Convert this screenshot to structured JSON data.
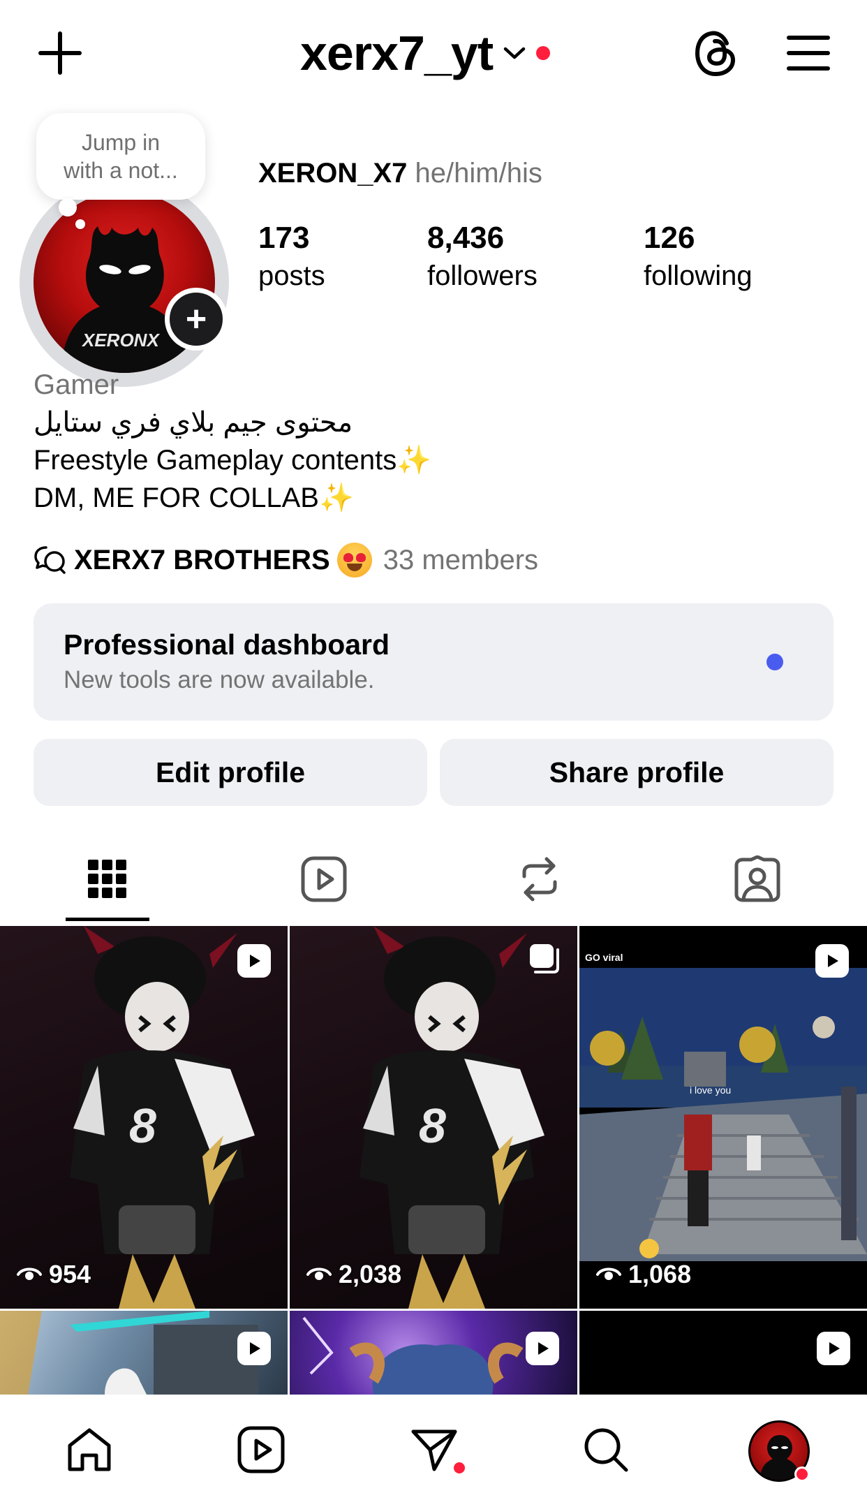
{
  "header": {
    "username": "xerx7_yt",
    "icons": [
      "plus-icon",
      "chevron-down-icon",
      "threads-icon",
      "menu-icon"
    ]
  },
  "note": {
    "line1": "Jump in",
    "line2": "with a not..."
  },
  "profile": {
    "display_name": "XERON_X7",
    "pronouns": "he/him/his",
    "avatar_text": "XERONX",
    "stats": {
      "posts": {
        "value": "173",
        "label": "posts"
      },
      "followers": {
        "value": "8,436",
        "label": "followers"
      },
      "following": {
        "value": "126",
        "label": "following"
      }
    }
  },
  "bio": {
    "category": "Gamer",
    "line_arabic": "محتوى جيم بلاي فري ستايل",
    "line2": "Freestyle Gameplay contents",
    "line3": "DM, ME FOR COLLAB"
  },
  "community": {
    "name": "XERX7 BROTHERS",
    "members": "33 members"
  },
  "dashboard": {
    "title": "Professional dashboard",
    "subtitle": "New tools are now available."
  },
  "buttons": {
    "edit": "Edit profile",
    "share": "Share profile"
  },
  "tabs": [
    "grid-icon",
    "reels-icon",
    "reposts-icon",
    "tagged-icon"
  ],
  "posts": [
    {
      "views": "954",
      "type": "reel"
    },
    {
      "views": "2,038",
      "type": "carousel"
    },
    {
      "views": "1,068",
      "type": "reel",
      "overlay_top": "GO viral",
      "overlay_mid": "i love you"
    },
    {
      "type": "reel"
    },
    {
      "type": "reel"
    },
    {
      "type": "reel"
    }
  ],
  "colors": {
    "notification_dot": "#ff1f3d",
    "dashboard_dot": "#4a5cf0",
    "surface": "#eff0f4",
    "secondary_text": "#737373"
  },
  "bottom_nav": [
    "home-icon",
    "reels-icon",
    "messages-icon",
    "search-icon",
    "profile-avatar"
  ]
}
